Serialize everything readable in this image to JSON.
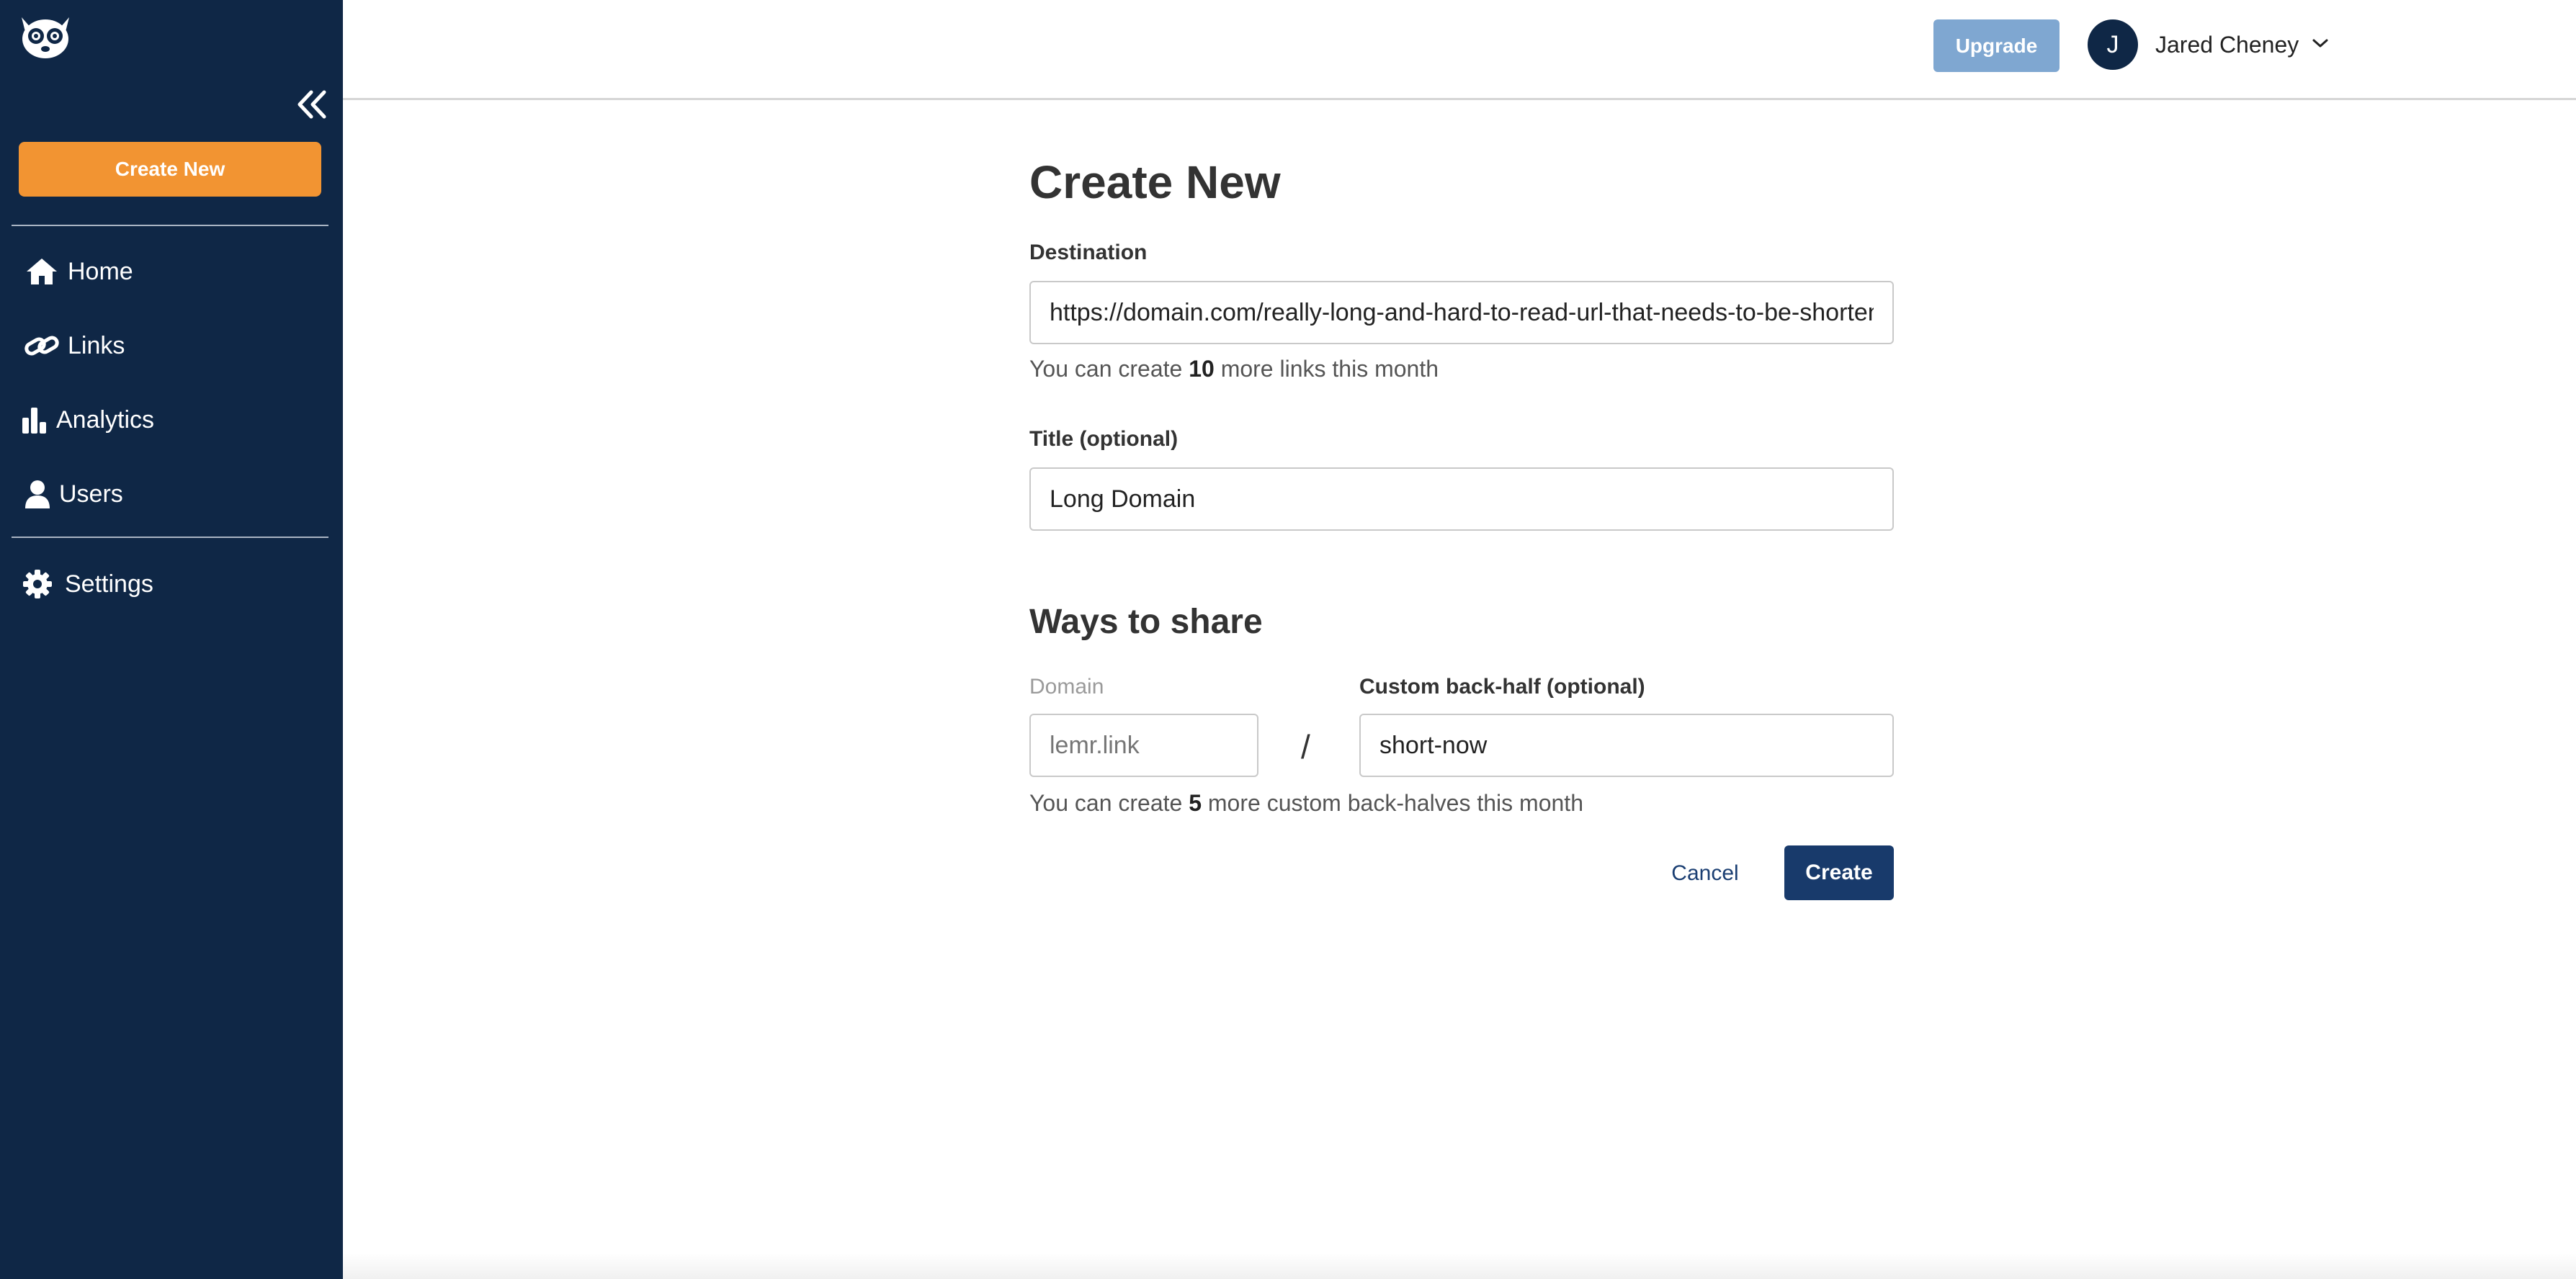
{
  "sidebar": {
    "create_new_label": "Create New",
    "items": [
      {
        "label": "Home",
        "icon": "home-icon"
      },
      {
        "label": "Links",
        "icon": "link-icon"
      },
      {
        "label": "Analytics",
        "icon": "bar-chart-icon"
      },
      {
        "label": "Users",
        "icon": "user-icon"
      },
      {
        "label": "Settings",
        "icon": "gear-icon"
      }
    ]
  },
  "header": {
    "upgrade_label": "Upgrade",
    "user_initial": "J",
    "user_name": "Jared Cheney"
  },
  "form": {
    "title": "Create New",
    "destination": {
      "label": "Destination",
      "value": "https://domain.com/really-long-and-hard-to-read-url-that-needs-to-be-shortened"
    },
    "links_helper": {
      "prefix": "You can create ",
      "count": "10",
      "suffix": " more links this month"
    },
    "title_field": {
      "label": "Title (optional)",
      "value": "Long Domain"
    },
    "share": {
      "heading": "Ways to share",
      "domain_label": "Domain",
      "domain_placeholder": "lemr.link",
      "separator": "/",
      "backhalf_label": "Custom back-half (optional)",
      "backhalf_value": "short-now"
    },
    "backhalf_helper": {
      "prefix": "You can create ",
      "count": "5",
      "suffix": " more custom back-halves this month"
    },
    "cancel_label": "Cancel",
    "create_label": "Create"
  },
  "colors": {
    "sidebar_bg": "#0f2746",
    "accent_orange": "#f29432",
    "primary_navy": "#183a6b",
    "upgrade_blue": "#7fa7d1"
  }
}
